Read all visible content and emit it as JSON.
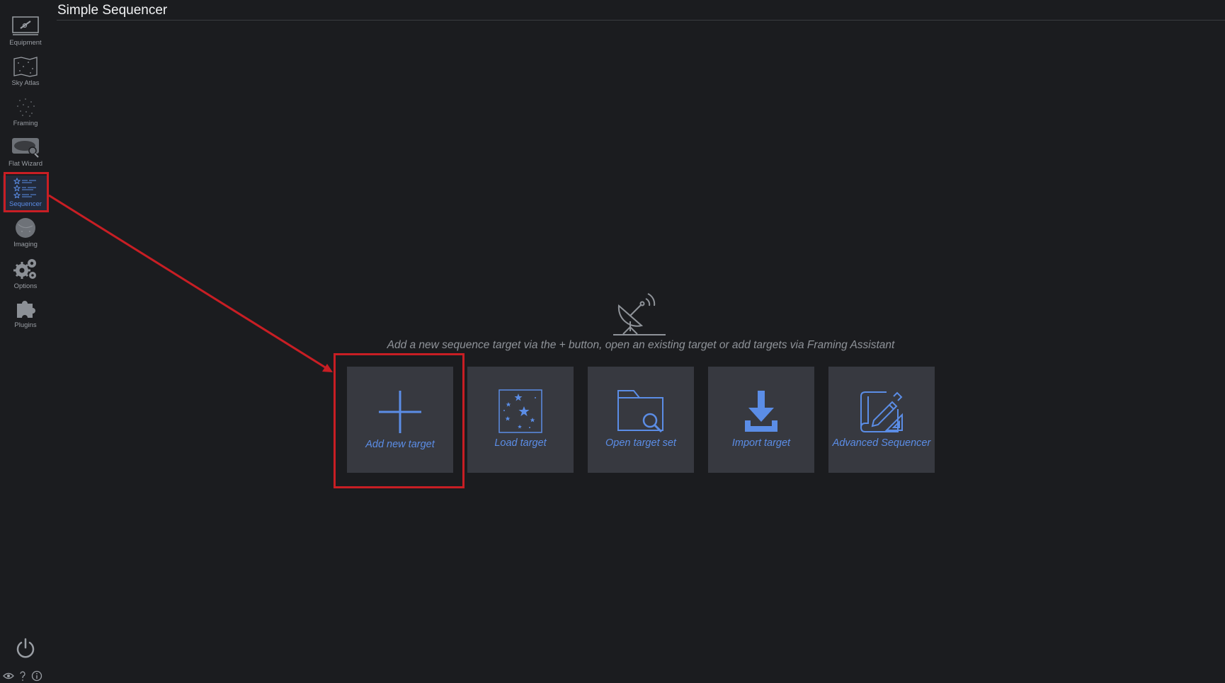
{
  "page": {
    "title": "Simple Sequencer",
    "hint": "Add a new sequence target via the + button, open an existing target or add targets via Framing Assistant"
  },
  "sidebar": {
    "items": [
      {
        "label": "Equipment",
        "icon": "telescope-icon"
      },
      {
        "label": "Sky Atlas",
        "icon": "sky-atlas-icon"
      },
      {
        "label": "Framing",
        "icon": "framing-icon"
      },
      {
        "label": "Flat Wizard",
        "icon": "flat-wizard-icon"
      },
      {
        "label": "Sequencer",
        "icon": "sequencer-icon",
        "active": true
      },
      {
        "label": "Imaging",
        "icon": "imaging-icon"
      },
      {
        "label": "Options",
        "icon": "gears-icon"
      },
      {
        "label": "Plugins",
        "icon": "puzzle-icon"
      }
    ]
  },
  "tiles": [
    {
      "label": "Add new target",
      "icon": "plus-icon"
    },
    {
      "label": "Load target",
      "icon": "stars-icon"
    },
    {
      "label": "Open target set",
      "icon": "folder-search-icon"
    },
    {
      "label": "Import target",
      "icon": "download-icon"
    },
    {
      "label": "Advanced Sequencer",
      "icon": "blueprint-icon"
    }
  ],
  "colors": {
    "background": "#1b1c1f",
    "tile": "#373940",
    "accent": "#5b8de6",
    "highlight": "#c81e24"
  }
}
